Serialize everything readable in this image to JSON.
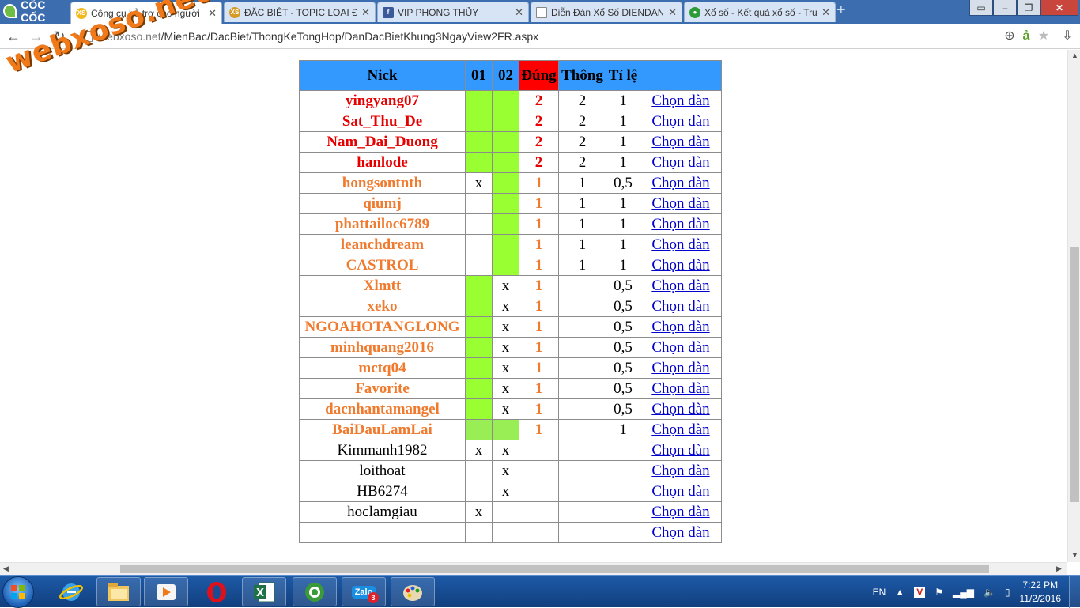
{
  "browser": {
    "brand": "CỐC CỐC",
    "tabs": [
      {
        "title": "Công cụ hỗ trợ cho người",
        "active": true
      },
      {
        "title": "ĐẶC BIỆT - TOPIC LOẠI ĐẶ",
        "active": false
      },
      {
        "title": "VIP PHONG THỦY",
        "active": false
      },
      {
        "title": "Diễn Đàn Xổ Số DIENDAN",
        "active": false
      },
      {
        "title": "Xổ số - Kết quả xổ số - Trự",
        "active": false
      }
    ],
    "url_dim": "webxoso.net",
    "url_path": "/MienBac/DacBiet/ThongKeTongHop/DanDacBietKhung3NgayView2FR.aspx"
  },
  "watermark": "webxoso.net",
  "table": {
    "headers": {
      "nick": "Nick",
      "c01": "01",
      "c02": "02",
      "dung": "Đúng",
      "thong": "Thông",
      "tile": "Tỉ lệ",
      "action": ""
    },
    "colors": {
      "header": "#3399ff",
      "highlight": "#ff0000",
      "green": "#99ff33"
    },
    "rows": [
      {
        "nick": "yingyang07",
        "c01": "",
        "c02": "",
        "g01": true,
        "g02": true,
        "dung": "2",
        "thong": "2",
        "tile": "1",
        "action": "Chọn dàn"
      },
      {
        "nick": "Sat_Thu_De",
        "c01": "",
        "c02": "",
        "g01": true,
        "g02": true,
        "dung": "2",
        "thong": "2",
        "tile": "1",
        "action": "Chọn dàn"
      },
      {
        "nick": "Nam_Dai_Duong",
        "c01": "",
        "c02": "",
        "g01": true,
        "g02": true,
        "dung": "2",
        "thong": "2",
        "tile": "1",
        "action": "Chọn dàn"
      },
      {
        "nick": "hanlode",
        "c01": "",
        "c02": "",
        "g01": true,
        "g02": true,
        "dung": "2",
        "thong": "2",
        "tile": "1",
        "action": "Chọn dàn"
      },
      {
        "nick": "hongsontnth",
        "c01": "x",
        "c02": "",
        "g01": false,
        "g02": true,
        "dung": "1",
        "thong": "1",
        "tile": "0,5",
        "action": "Chọn dàn"
      },
      {
        "nick": "qiumj",
        "c01": "",
        "c02": "",
        "g01": false,
        "g02": true,
        "dung": "1",
        "thong": "1",
        "tile": "1",
        "action": "Chọn dàn"
      },
      {
        "nick": "phattailoc6789",
        "c01": "",
        "c02": "",
        "g01": false,
        "g02": true,
        "dung": "1",
        "thong": "1",
        "tile": "1",
        "action": "Chọn dàn"
      },
      {
        "nick": "leanchdream",
        "c01": "",
        "c02": "",
        "g01": false,
        "g02": true,
        "dung": "1",
        "thong": "1",
        "tile": "1",
        "action": "Chọn dàn"
      },
      {
        "nick": "CASTROL",
        "c01": "",
        "c02": "",
        "g01": false,
        "g02": true,
        "dung": "1",
        "thong": "1",
        "tile": "1",
        "action": "Chọn dàn"
      },
      {
        "nick": "Xlmtt",
        "c01": "",
        "c02": "x",
        "g01": true,
        "g02": false,
        "dung": "1",
        "thong": "",
        "tile": "0,5",
        "action": "Chọn dàn"
      },
      {
        "nick": "xeko",
        "c01": "",
        "c02": "x",
        "g01": true,
        "g02": false,
        "dung": "1",
        "thong": "",
        "tile": "0,5",
        "action": "Chọn dàn"
      },
      {
        "nick": "NGOAHOTANGLONG",
        "c01": "",
        "c02": "x",
        "g01": true,
        "g02": false,
        "dung": "1",
        "thong": "",
        "tile": "0,5",
        "action": "Chọn dàn"
      },
      {
        "nick": "minhquang2016",
        "c01": "",
        "c02": "x",
        "g01": true,
        "g02": false,
        "dung": "1",
        "thong": "",
        "tile": "0,5",
        "action": "Chọn dàn"
      },
      {
        "nick": "mctq04",
        "c01": "",
        "c02": "x",
        "g01": true,
        "g02": false,
        "dung": "1",
        "thong": "",
        "tile": "0,5",
        "action": "Chọn dàn"
      },
      {
        "nick": "Favorite",
        "c01": "",
        "c02": "x",
        "g01": true,
        "g02": false,
        "dung": "1",
        "thong": "",
        "tile": "0,5",
        "action": "Chọn dàn"
      },
      {
        "nick": "dacnhantamangel",
        "c01": "",
        "c02": "x",
        "g01": true,
        "g02": false,
        "dung": "1",
        "thong": "",
        "tile": "0,5",
        "action": "Chọn dàn"
      },
      {
        "nick": "BaiDauLamLai",
        "c01": "",
        "c02": "",
        "g01": true,
        "g02": true,
        "dung": "1",
        "thong": "",
        "tile": "1",
        "action": "Chọn dàn"
      },
      {
        "nick": "Kimmanh1982",
        "c01": "x",
        "c02": "x",
        "g01": false,
        "g02": false,
        "dung": "",
        "thong": "",
        "tile": "",
        "action": "Chọn dàn"
      },
      {
        "nick": "loithoat",
        "c01": "",
        "c02": "x",
        "g01": false,
        "g02": false,
        "dung": "",
        "thong": "",
        "tile": "",
        "action": "Chọn dàn"
      },
      {
        "nick": "HB6274",
        "c01": "",
        "c02": "x",
        "g01": false,
        "g02": false,
        "dung": "",
        "thong": "",
        "tile": "",
        "action": "Chọn dàn"
      },
      {
        "nick": "hoclamgiau",
        "c01": "x",
        "c02": "",
        "g01": false,
        "g02": false,
        "dung": "",
        "thong": "",
        "tile": "",
        "action": "Chọn dàn"
      },
      {
        "nick": "",
        "c01": "",
        "c02": "",
        "g01": false,
        "g02": false,
        "dung": "",
        "thong": "",
        "tile": "",
        "action": "Chọn dàn"
      }
    ]
  },
  "taskbar": {
    "apps": [
      "internet-explorer",
      "file-explorer",
      "media-player",
      "opera",
      "excel",
      "coccoc",
      "zalo",
      "paint"
    ],
    "zalo_label": "Zalo",
    "zalo_badge": "3",
    "language": "EN",
    "time": "7:22 PM",
    "date": "11/2/2016"
  }
}
